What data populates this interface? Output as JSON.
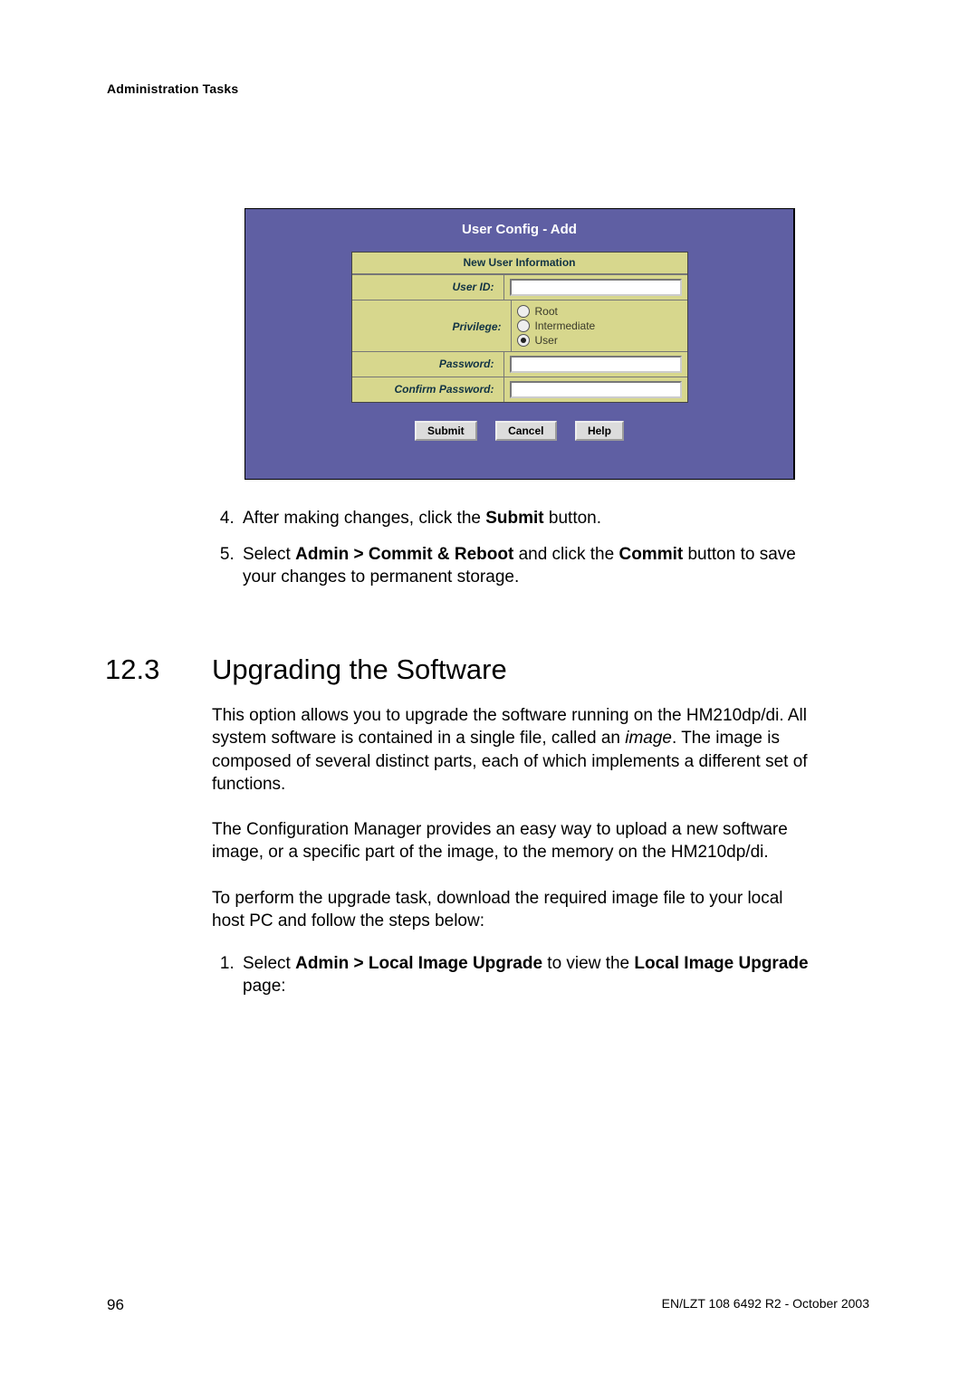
{
  "header": {
    "title": "Administration Tasks"
  },
  "screenshot": {
    "title": "User Config - Add",
    "caption": "New User Information",
    "rows": {
      "user_id_label": "User ID:",
      "privilege_label": "Privilege:",
      "password_label": "Password:",
      "confirm_label": "Confirm Password:"
    },
    "privilege_options": {
      "root": "Root",
      "intermediate": "Intermediate",
      "user": "User"
    },
    "buttons": {
      "submit": "Submit",
      "cancel": "Cancel",
      "help": "Help"
    }
  },
  "steps_a": {
    "s4_pre": "After making changes, click the ",
    "s4_b": "Submit",
    "s4_post": " button.",
    "s5_pre": "Select ",
    "s5_b1": "Admin > Commit & Reboot",
    "s5_mid": " and click the ",
    "s5_b2": "Commit",
    "s5_post": " button to save your changes to permanent storage."
  },
  "section": {
    "num": "12.3",
    "title": "Upgrading the Software"
  },
  "p1": {
    "t1": "This option allows you to upgrade the software running on the HM210dp/di. All system software is contained in a single file, called an ",
    "em": "image",
    "t2": ". The image is composed of several distinct parts, each of which implements a different set of functions."
  },
  "p2": "The Configuration Manager provides an easy way to upload a new software image, or a specific part of the image, to the memory on the HM210dp/di.",
  "p3": "To perform the upgrade task, download the required image file to your local host PC and follow the steps below:",
  "steps_b": {
    "s1_pre": "Select ",
    "s1_b1": "Admin > Local Image Upgrade",
    "s1_mid": " to view the ",
    "s1_b2": "Local Image Upgrade",
    "s1_post": " page:"
  },
  "footer": {
    "page": "96",
    "doccode": "EN/LZT 108 6492 R2  - October 2003"
  }
}
